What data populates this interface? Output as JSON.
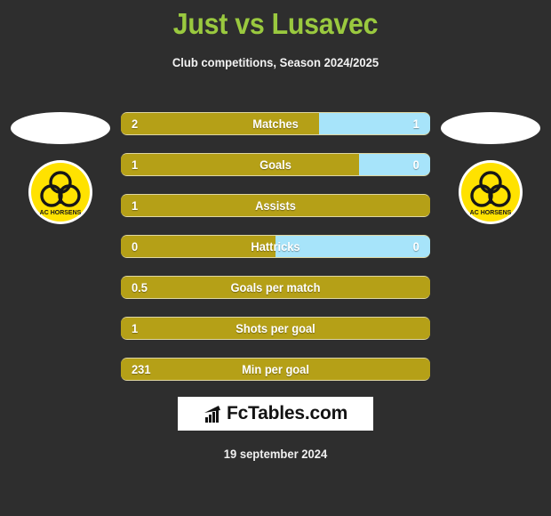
{
  "header": {
    "title": "Just vs Lusavec",
    "subtitle": "Club competitions, Season 2024/2025",
    "title_color": "#9ac93f"
  },
  "teams": {
    "home": {
      "club_name": "AC HORSENS",
      "badge_color": "#ffe200",
      "bar_color": "#b5a017"
    },
    "away": {
      "club_name": "AC HORSENS",
      "badge_color": "#ffe200",
      "bar_color": "#a7e4fa"
    }
  },
  "stats": [
    {
      "label": "Matches",
      "home": "2",
      "away": "1",
      "home_pct": 64,
      "show_away": true
    },
    {
      "label": "Goals",
      "home": "1",
      "away": "0",
      "home_pct": 77,
      "show_away": true
    },
    {
      "label": "Assists",
      "home": "1",
      "away": "",
      "home_pct": 100,
      "show_away": false
    },
    {
      "label": "Hattricks",
      "home": "0",
      "away": "0",
      "home_pct": 50,
      "show_away": true
    },
    {
      "label": "Goals per match",
      "home": "0.5",
      "away": "",
      "home_pct": 100,
      "show_away": false
    },
    {
      "label": "Shots per goal",
      "home": "1",
      "away": "",
      "home_pct": 100,
      "show_away": false
    },
    {
      "label": "Min per goal",
      "home": "231",
      "away": "",
      "home_pct": 100,
      "show_away": false
    }
  ],
  "footer": {
    "brand_text": "FcTables.com",
    "brand_icon": "bar-chart-icon",
    "date": "19 september 2024"
  }
}
